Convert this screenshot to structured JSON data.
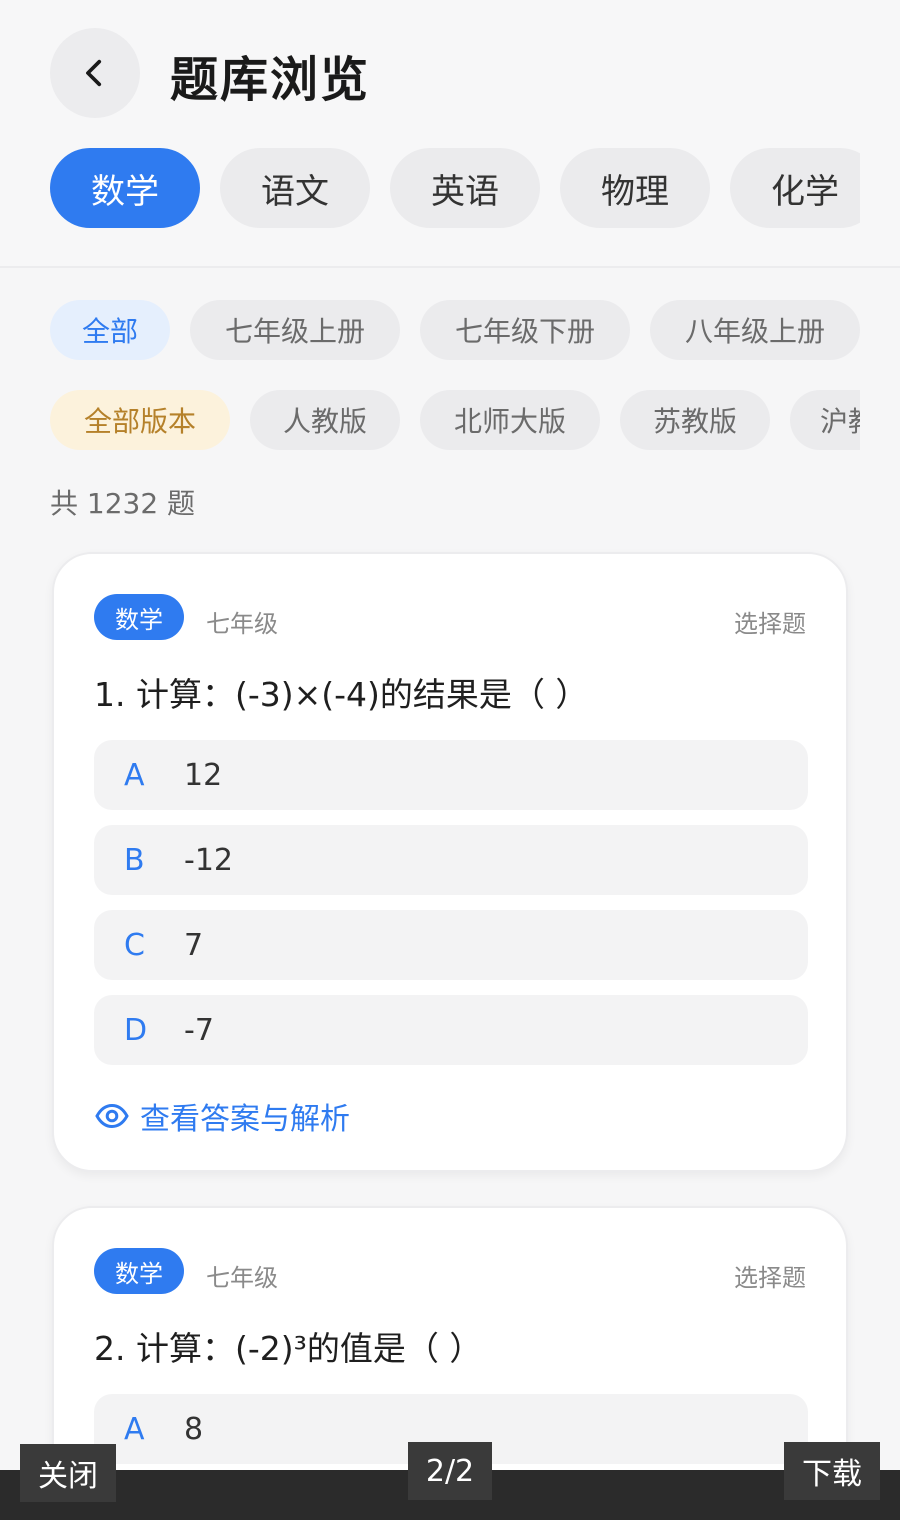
{
  "header": {
    "title": "题库浏览",
    "subjects": [
      "数学",
      "语文",
      "英语",
      "物理",
      "化学"
    ],
    "active_subject": "数学"
  },
  "filters": {
    "grades": [
      "全部",
      "七年级上册",
      "七年级下册",
      "八年级上册"
    ],
    "versions": [
      "全部版本",
      "人教版",
      "北师大版",
      "苏教版",
      "沪教"
    ]
  },
  "count_text": "共 1232 题",
  "questions": [
    {
      "subject_tag": "数学",
      "grade": "七年级",
      "type": "选择题",
      "stem": "1. 计算：(-3)×(-4)的结果是（ ）",
      "options": [
        {
          "letter": "A",
          "value": "12"
        },
        {
          "letter": "B",
          "value": "-12"
        },
        {
          "letter": "C",
          "value": "7"
        },
        {
          "letter": "D",
          "value": "-7"
        }
      ],
      "view_answer": "查看答案与解析"
    },
    {
      "subject_tag": "数学",
      "grade": "七年级",
      "type": "选择题",
      "stem": "2. 计算：(-2)³的值是（ ）",
      "options": [
        {
          "letter": "A",
          "value": "8"
        }
      ]
    }
  ],
  "viewer": {
    "close_label": "关闭",
    "page_indicator": "2/2",
    "download_label": "下载"
  },
  "colors": {
    "accent": "#2f7bf0",
    "version_active_bg": "#fcf2dc",
    "version_active_text": "#b5812a"
  },
  "icons": {
    "back": "chevron-left-icon",
    "view_answer": "eye-icon"
  }
}
